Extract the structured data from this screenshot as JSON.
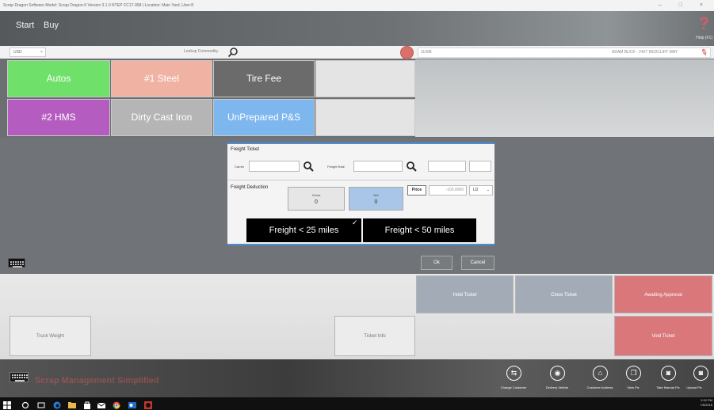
{
  "window": {
    "title": "Scrap Dragon Software Model: Scrap Dragon-II Version 3.1.0 NTEP CC17-068 | Location: Main Yard, User:8",
    "controls": "– □ ×"
  },
  "header": {
    "nav": [
      "Start",
      "Buy"
    ],
    "help_label": "Help (F1)"
  },
  "search": {
    "currency": "USD",
    "lookup_label": "Lookup Commodity",
    "customer_id": "11998",
    "customer_name": "ADAM BUCK - 2427 REDCLIFF WAY"
  },
  "commodities": [
    {
      "label": "Autos",
      "color": "#6fe06a"
    },
    {
      "label": "#1 Steel",
      "color": "#f0b3a3"
    },
    {
      "label": "Tire Fee",
      "color": "#6b6b6b"
    },
    {
      "label": "",
      "color": "#e4e4e4"
    },
    {
      "label": "#2 HMS",
      "color": "#b55cc0"
    },
    {
      "label": "Dirty Cast Iron",
      "color": "#b5b5b5"
    },
    {
      "label": "UnPrepared P&S",
      "color": "#7db7ee"
    },
    {
      "label": "",
      "color": "#e4e4e4"
    }
  ],
  "freight": {
    "section_title": "Freight Ticket",
    "carrier_label": "Carrier",
    "carrier_value": "",
    "rate_label": "Freight Rate",
    "rate_value": "",
    "deduction_label": "Freight Deduction",
    "gross_label": "Gross",
    "gross_value": "0",
    "net_label": "Net",
    "net_value": "0",
    "price_label": "Price",
    "price_value": "-100.0000",
    "unit": "LD",
    "option_1": "Freight < 25 miles",
    "option_2": "Freight < 50 miles",
    "option_1_selected": true
  },
  "dialog_actions": {
    "ok": "Ok",
    "cancel": "Cancel"
  },
  "ticket_actions": {
    "hold": "Hold Ticket",
    "close": "Close Ticket",
    "awaiting": "Awaiting Approval",
    "truck_weight": "Truck Weight",
    "ticket_info": "Ticket Info",
    "void": "Void Ticket"
  },
  "customer_tools": [
    {
      "label": "Change Customer",
      "icon": "person-swap-icon"
    },
    {
      "label": "Delivery Vehicle",
      "icon": "car-icon"
    },
    {
      "label": "Customer Address",
      "icon": "address-icon"
    },
    {
      "label": "View Pix",
      "icon": "gallery-icon"
    },
    {
      "label": "Take Manual Pix",
      "icon": "camera-icon"
    },
    {
      "label": "Upload Pix",
      "icon": "camera-upload-icon"
    }
  ],
  "watermark": "Scrap Management Simplified",
  "taskbar": {
    "time": "3:32 PM",
    "date": "7/6/2018"
  },
  "colors": {
    "accent": "#4a8fd6",
    "danger": "#d9706a",
    "net_box": "#a9c6e8"
  }
}
